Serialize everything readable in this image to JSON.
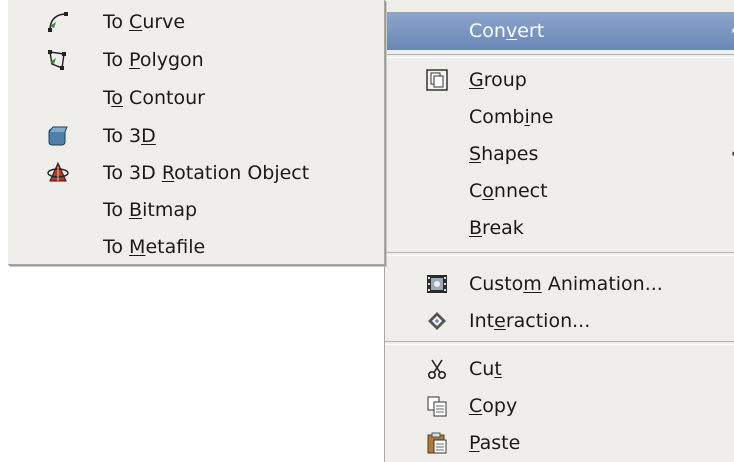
{
  "main_menu": {
    "items": [
      {
        "name": "menu-item-convert",
        "label": "Convert",
        "mnemonic": "v",
        "icon": null,
        "submenu": true,
        "highlighted": true
      },
      {
        "name": "menu-item-group",
        "label": "Group",
        "mnemonic": "G",
        "icon": "group-icon"
      },
      {
        "name": "menu-item-combine",
        "label": "Combine",
        "mnemonic": "i",
        "icon": null
      },
      {
        "name": "menu-item-shapes",
        "label": "Shapes",
        "mnemonic": "S",
        "icon": null,
        "submenu": true
      },
      {
        "name": "menu-item-connect",
        "label": "Connect",
        "mnemonic": "o",
        "icon": null
      },
      {
        "name": "menu-item-break",
        "label": "Break",
        "mnemonic": "B",
        "icon": null
      },
      {
        "name": "menu-item-custom-animation",
        "label": "Custom Animation...",
        "mnemonic": "m",
        "icon": "animation-film-icon"
      },
      {
        "name": "menu-item-interaction",
        "label": "Interaction...",
        "mnemonic": "e",
        "icon": "interaction-icon"
      },
      {
        "name": "menu-item-cut",
        "label": "Cut",
        "mnemonic": "t",
        "icon": "scissors-icon"
      },
      {
        "name": "menu-item-copy",
        "label": "Copy",
        "mnemonic": "C",
        "icon": "copy-icon"
      },
      {
        "name": "menu-item-paste",
        "label": "Paste",
        "mnemonic": "P",
        "icon": "paste-icon"
      }
    ]
  },
  "convert_submenu": {
    "items": [
      {
        "name": "submenu-item-to-curve",
        "label": "To Curve",
        "mnemonic": "C",
        "icon": "bezier-curve-icon"
      },
      {
        "name": "submenu-item-to-polygon",
        "label": "To Polygon",
        "mnemonic": "P",
        "icon": "polygon-icon"
      },
      {
        "name": "submenu-item-to-contour",
        "label": "To Contour",
        "mnemonic": "o",
        "icon": null
      },
      {
        "name": "submenu-item-to-3d",
        "label": "To 3D",
        "mnemonic": "D",
        "icon": "cube-3d-icon"
      },
      {
        "name": "submenu-item-to-3d-rotation",
        "label": "To 3D Rotation Object",
        "mnemonic": "R",
        "icon": "rotation-object-icon"
      },
      {
        "name": "submenu-item-to-bitmap",
        "label": "To Bitmap",
        "mnemonic": "B",
        "icon": null
      },
      {
        "name": "submenu-item-to-metafile",
        "label": "To Metafile",
        "mnemonic": "M",
        "icon": null
      }
    ]
  },
  "colors": {
    "menu_bg": "#efeeea",
    "highlight": "#7893bf",
    "text": "#1a1a1a"
  }
}
